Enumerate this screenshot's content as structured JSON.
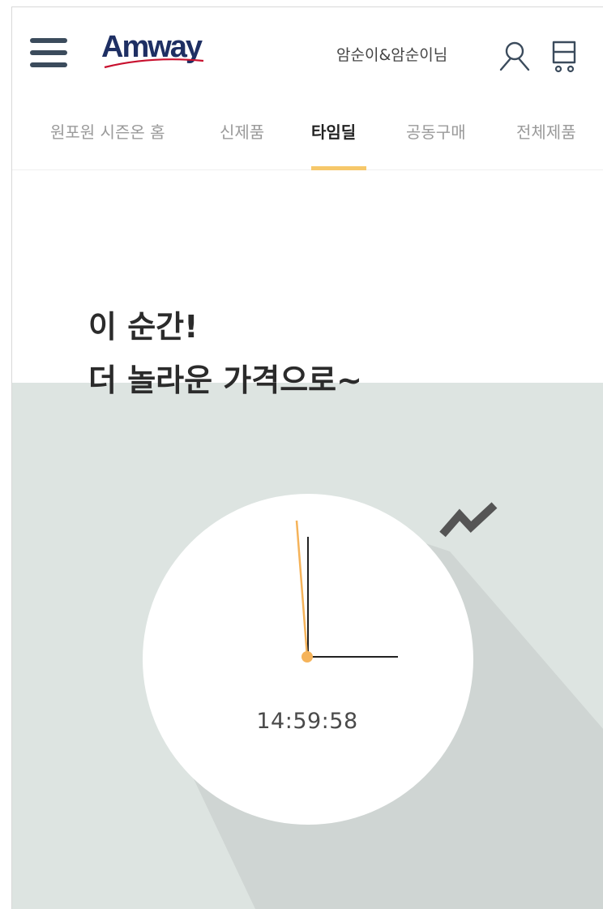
{
  "header": {
    "logo_text": "Amway",
    "user_greeting": "암순이&암순이님",
    "menu_icon": "hamburger-menu-icon",
    "user_icon": "user-icon",
    "cart_icon": "cart-icon"
  },
  "tabs": [
    {
      "label": "원포원 시즌온 홈",
      "active": false
    },
    {
      "label": "신제품",
      "active": false
    },
    {
      "label": "타임딜",
      "active": true
    },
    {
      "label": "공동구매",
      "active": false
    },
    {
      "label": "전체제품",
      "active": false
    }
  ],
  "hero": {
    "title_line1": "이 순간!",
    "title_line2": "더 놀라운 가격으로~",
    "clock_time": "14:59:58"
  },
  "colors": {
    "accent": "#f6c86a",
    "logo": "#1e2f63",
    "hero_band": "#dde4e1",
    "clock_shadow": "#cfd5d3",
    "second_hand": "#f5b35a"
  }
}
